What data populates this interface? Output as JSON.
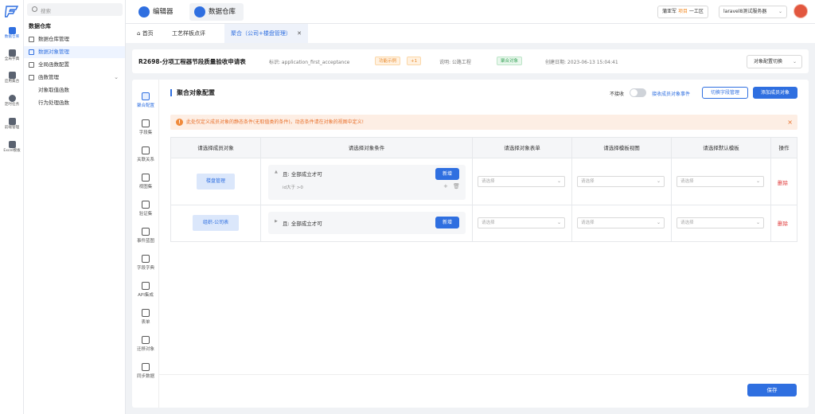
{
  "rail": {
    "items": [
      {
        "label": "数据仓库",
        "icon": "database-icon"
      },
      {
        "label": "全局字典",
        "icon": "dictionary-icon"
      },
      {
        "label": "应用集合",
        "icon": "apps-icon"
      },
      {
        "label": "定时任务",
        "icon": "clock-icon"
      },
      {
        "label": "前端管理",
        "icon": "frontend-icon"
      },
      {
        "label": "Excel模板",
        "icon": "excel-icon"
      }
    ]
  },
  "sidebar": {
    "search_placeholder": "搜索",
    "title": "数据仓库",
    "items": [
      {
        "label": "数据仓库管理"
      },
      {
        "label": "数据对象管理"
      },
      {
        "label": "全局函数配置"
      },
      {
        "label": "函数管理"
      },
      {
        "label": "对象取值函数"
      },
      {
        "label": "行为处理函数"
      }
    ]
  },
  "topbar": {
    "apps": [
      {
        "label": "编辑器"
      },
      {
        "label": "数据仓库"
      }
    ],
    "user": {
      "name": "蒲亚军",
      "role": "项目",
      "org": "一工区"
    },
    "server": "laravel8测试服务器"
  },
  "tabs": [
    {
      "label": "首页"
    },
    {
      "label": "工艺样板点评"
    },
    {
      "label": "聚合（公司+楼盘管理）"
    }
  ],
  "detail": {
    "title": "R2698-分项工程器节段质量验收申请表",
    "identifier": "标识: application_first_acceptance",
    "tag_func": "功能示例",
    "tag_count": "+1",
    "desc": "说明: 公路工程",
    "tag_type": "聚合对象",
    "created": "创建日期: 2023-06-13 15:04:41",
    "switch_label": "对象配置切换"
  },
  "leftnav": [
    {
      "label": "聚合配置",
      "icon": "aggregate-icon"
    },
    {
      "label": "字段集",
      "icon": "field-icon"
    },
    {
      "label": "关联关系",
      "icon": "link-icon"
    },
    {
      "label": "视图集",
      "icon": "view-icon"
    },
    {
      "label": "验证集",
      "icon": "verify-icon"
    },
    {
      "label": "事件蓝图",
      "icon": "event-icon"
    },
    {
      "label": "字段字典",
      "icon": "dict-icon"
    },
    {
      "label": "API集成",
      "icon": "api-icon"
    },
    {
      "label": "表单",
      "icon": "form-icon"
    },
    {
      "label": "迁移对象",
      "icon": "migrate-icon"
    },
    {
      "label": "同步数据",
      "icon": "sync-icon"
    }
  ],
  "section": {
    "title": "聚合对象配置",
    "toggle_label": "不接收",
    "link": "接收成员对象事件",
    "btn_switch": "切换字段管理",
    "btn_add": "添加成员对象"
  },
  "alert": "此处仅定义成员对象的静态条件(无取值类的条件)，动态条件请在对象的视图中定义!",
  "table": {
    "headers": [
      "请选择成员对象",
      "请选择对象条件",
      "请选择对象表单",
      "请选择模板视图",
      "请选择默认模板",
      "操作"
    ],
    "rows": [
      {
        "member": "楼盘管理",
        "cond": "且: 全部成立才可",
        "cond_sub": "id大于 >0",
        "add": "新增",
        "select": "请选择",
        "del": "删除"
      },
      {
        "member": "组织-公司表",
        "cond": "且: 全部成立才可",
        "add": "新增",
        "select": "请选择",
        "del": "删除"
      }
    ]
  },
  "save_label": "保存"
}
